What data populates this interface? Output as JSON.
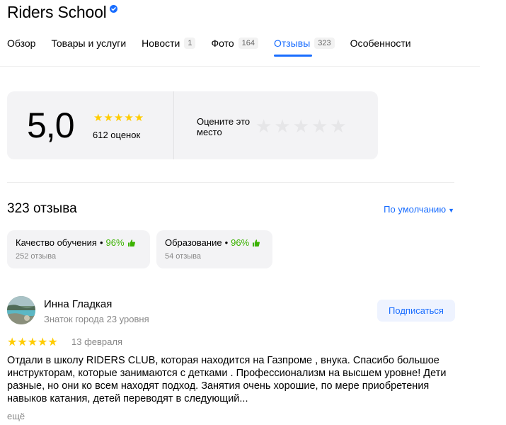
{
  "header": {
    "title": "Riders School",
    "verified_icon": "verified-check-icon"
  },
  "tabs": [
    {
      "label": "Обзор",
      "count": null,
      "active": false
    },
    {
      "label": "Товары и услуги",
      "count": null,
      "active": false
    },
    {
      "label": "Новости",
      "count": "1",
      "active": false
    },
    {
      "label": "Фото",
      "count": "164",
      "active": false
    },
    {
      "label": "Отзывы",
      "count": "323",
      "active": true
    },
    {
      "label": "Особенности",
      "count": null,
      "active": false
    }
  ],
  "rating": {
    "score": "5,0",
    "stars": "★★★★★",
    "count_text": "612 оценок",
    "rate_prompt": "Оцените это место",
    "rate_stars": [
      "★",
      "★",
      "★",
      "★",
      "★"
    ]
  },
  "reviews": {
    "title": "323 отзыва",
    "sort_label": "По умолчанию",
    "sort_caret": "▼"
  },
  "aspects": [
    {
      "name": "Качество обучения",
      "dot": "•",
      "percent": "96%",
      "count": "252 отзыва",
      "icon": "thumbs-up-icon"
    },
    {
      "name": "Образование",
      "dot": "•",
      "percent": "96%",
      "count": "54 отзыва",
      "icon": "thumbs-up-icon"
    }
  ],
  "review": {
    "author": "Инна Гладкая",
    "level": "Знаток города 23 уровня",
    "subscribe_label": "Подписаться",
    "stars": "★★★★★",
    "date": "13 февраля",
    "text": "Отдали в школу RIDERS CLUB, которая находится на Газпроме , внука. Спасибо большое инструкторам, которые занимаются с детками . Профессионализм на высшем уровне! Дети разные, но они ко всем находят подход. Занятия очень хорошие, по мере приобретения навыков катания, детей переводят в следующий...",
    "more_label": "ещё"
  },
  "colors": {
    "accent": "#196dff",
    "star_gold": "#ffcc00",
    "positive": "#3bb200",
    "card_bg": "#f3f3f5"
  }
}
